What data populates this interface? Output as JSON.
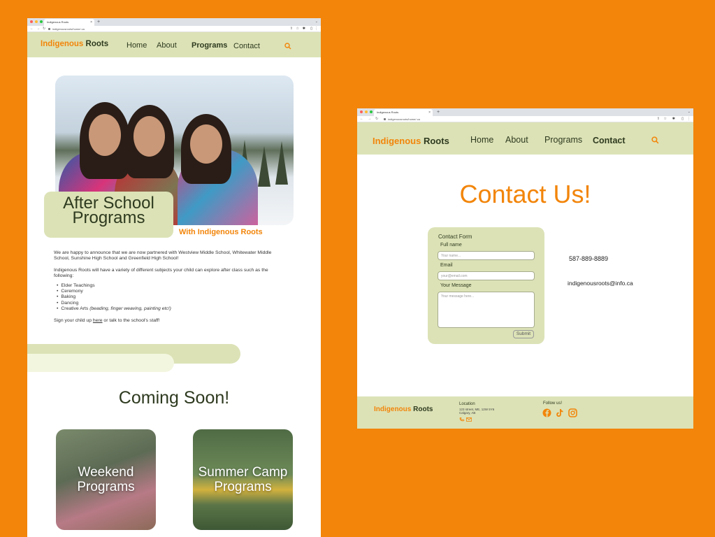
{
  "left": {
    "tab_title": "Indigenous Roots",
    "url": "indigenousroots/home/.ca",
    "logo": {
      "part1": "Indigenous",
      "part2": "Roots"
    },
    "nav": [
      "Home",
      "About",
      "Programs",
      "Contact"
    ],
    "active_nav": "Programs",
    "hero_title_line1": "After School",
    "hero_title_line2": "Programs",
    "hero_subtitle": "With Indigenous Roots",
    "para1": "We are happy to announce that we are now partnered with Westview Middle School, Whitewater Middle School, Sunshine High School and Greenfield High School!",
    "para2": "Indigenous Roots will have a variety of different subjects your child can explore after class such as the following:",
    "subjects": [
      "Elder Teachings",
      "Ceremony",
      "Baking",
      "Dancing",
      "Creative Arts"
    ],
    "creative_note": "(beading, finger weaving, painting etc!)",
    "signup_prefix": "Sign your child up ",
    "signup_link": "here",
    "signup_suffix": " or talk to the school's staff!",
    "coming_soon": "Coming Soon!",
    "cards": [
      {
        "line1": "Weekend",
        "line2": "Programs"
      },
      {
        "line1": "Summer Camp",
        "line2": "Programs"
      }
    ]
  },
  "right": {
    "tab_title": "Indigenous Roots",
    "url": "indigenousroots/home/.ca",
    "logo": {
      "part1": "Indigenous",
      "part2": "Roots"
    },
    "nav": [
      "Home",
      "About",
      "Programs",
      "Contact"
    ],
    "active_nav": "Contact",
    "title": "Contact Us!",
    "form": {
      "heading": "Contact Form",
      "name_label": "Full name",
      "name_placeholder": "Your name...",
      "email_label": "Email",
      "email_placeholder": "your@email.com",
      "message_label": "Your Message",
      "message_placeholder": "Your message here...",
      "submit": "Submit"
    },
    "phone": "587-889-8889",
    "email": "indigenousroots@info.ca",
    "footer": {
      "logo": {
        "part1": "Indigenous",
        "part2": "Roots"
      },
      "location_heading": "Location",
      "address_line1": "123 street, ME, 12W 5Y6",
      "address_line2": "Calgary, AB",
      "follow_heading": "Follow us!",
      "social": [
        "facebook",
        "tiktok",
        "instagram"
      ]
    }
  },
  "colors": {
    "background": "#F2850A",
    "accent": "#F2850A",
    "header_green": "#DCE2B6",
    "dark_text": "#2E3A1F"
  }
}
